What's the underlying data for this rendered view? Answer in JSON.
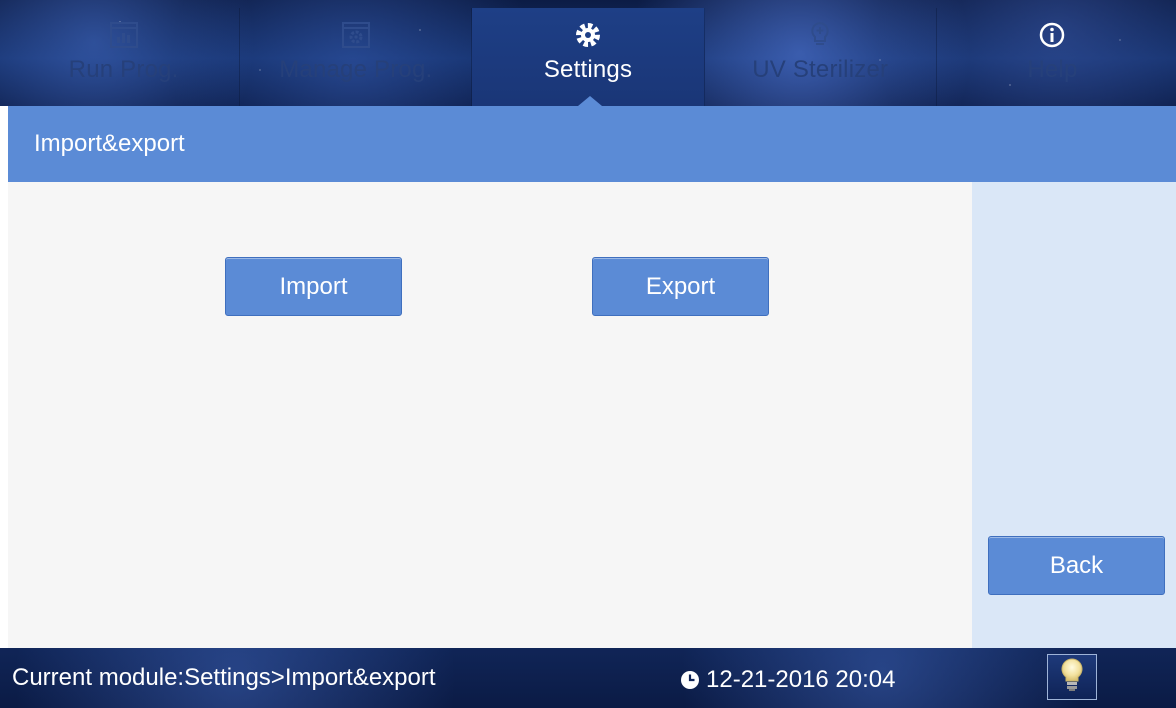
{
  "tabs": [
    {
      "label": "Run Prog.",
      "icon": "run-program-chart-icon",
      "active": false
    },
    {
      "label": "Manage Prog.",
      "icon": "manage-program-gear-icon",
      "active": false
    },
    {
      "label": "Settings",
      "icon": "gear-icon",
      "active": true
    },
    {
      "label": "UV Sterilizer",
      "icon": "uv-bulb-icon",
      "active": false
    },
    {
      "label": "Help",
      "icon": "info-icon",
      "active": false
    }
  ],
  "page_title": "Import&export",
  "buttons": {
    "import_label": "Import",
    "export_label": "Export",
    "back_label": "Back"
  },
  "status": {
    "module_text": "Current module:Settings>Import&export",
    "datetime": "12-21-2016 20:04",
    "clock_icon": "clock-icon",
    "lamp_icon": "light-bulb-icon"
  },
  "colors": {
    "accent": "#5b8bd6",
    "panel": "#dae7f7",
    "content_bg": "#f6f6f6",
    "header_dark": "#14306b"
  }
}
